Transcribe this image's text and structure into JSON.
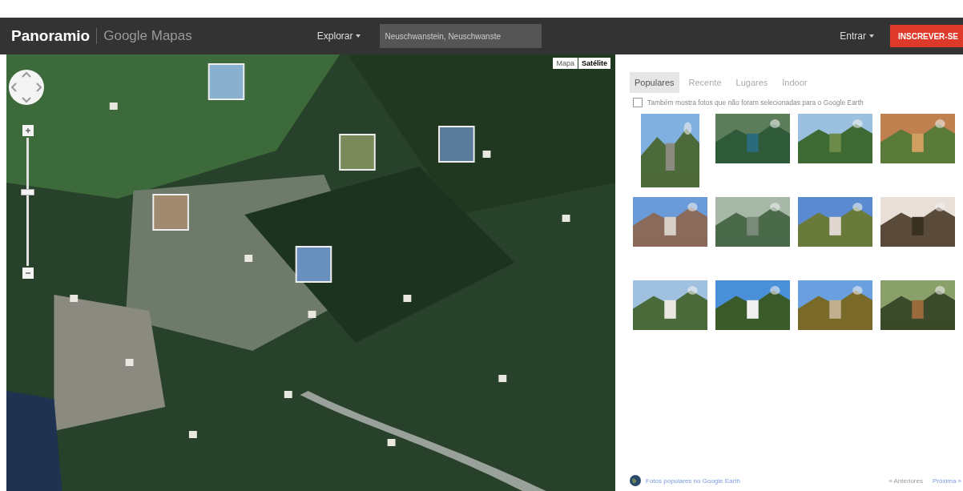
{
  "header": {
    "logo": "Panoramio",
    "product": "Google Mapas",
    "explore": "Explorar",
    "search": {
      "value": "Neuschwanstein, Neuschwanste"
    },
    "signin": "Entrar",
    "signup": "INSCREVER-SE"
  },
  "map": {
    "kind": "picture",
    "map_types": [
      {
        "label": "Mapa",
        "selected": false
      },
      {
        "label": "Satélite",
        "selected": true
      }
    ],
    "zoom": {
      "level": 0.6
    }
  },
  "tabs": [
    {
      "label": "Populares",
      "selected": true
    },
    {
      "label": "Recente",
      "selected": false
    },
    {
      "label": "Lugares",
      "selected": false
    },
    {
      "label": "Indoor",
      "selected": false
    }
  ],
  "earth_option": {
    "label": "Também mostra fotos que não foram selecionadas para o Google Earth",
    "checked": false
  },
  "footer": {
    "earth_link": "Fotos populares no Google Earth",
    "previous": "« Anteriores",
    "next": "Próxima »"
  }
}
